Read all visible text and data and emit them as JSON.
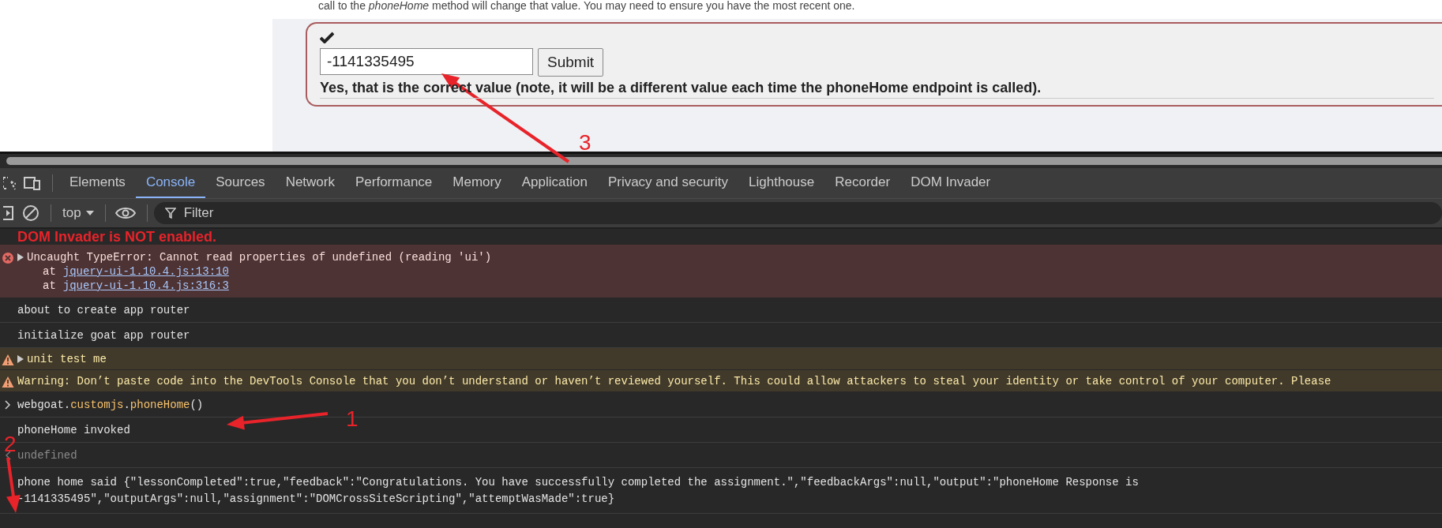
{
  "page": {
    "intro": "call to the *phoneHome* method will change that value. You may need to ensure you have the most recent one.",
    "form": {
      "checked": true,
      "answer": "-1141335495",
      "button": "Submit",
      "feedback": "Yes, that is the correct value (note, it will be a different value each time the phoneHome endpoint is called)."
    }
  },
  "devtools": {
    "tabs": [
      {
        "label": "Elements",
        "selected": false
      },
      {
        "label": "Console",
        "selected": true
      },
      {
        "label": "Sources",
        "selected": false
      },
      {
        "label": "Network",
        "selected": false
      },
      {
        "label": "Performance",
        "selected": false
      },
      {
        "label": "Memory",
        "selected": false
      },
      {
        "label": "Application",
        "selected": false
      },
      {
        "label": "Privacy and security",
        "selected": false
      },
      {
        "label": "Lighthouse",
        "selected": false
      },
      {
        "label": "Recorder",
        "selected": false
      },
      {
        "label": "DOM Invader",
        "selected": false
      }
    ],
    "context": "top",
    "filter_placeholder": "Filter",
    "banner": "DOM Invader is NOT enabled.",
    "messages": [
      {
        "kind": "error",
        "expandable": true,
        "text": "Uncaught TypeError: Cannot read properties of undefined (reading 'ui')",
        "stack": [
          {
            "prefix": "at",
            "link": "jquery-ui-1.10.4.js:13:10"
          },
          {
            "prefix": "at",
            "link": "jquery-ui-1.10.4.js:316:3"
          }
        ]
      },
      {
        "kind": "log",
        "text": "about to create app router"
      },
      {
        "kind": "log",
        "text": "initialize goat app router"
      },
      {
        "kind": "warning",
        "expandable": true,
        "text": "unit test me"
      },
      {
        "kind": "warning",
        "expandable": false,
        "text": "Warning: Don’t paste code into the DevTools Console that you don’t understand or haven’t reviewed yourself. This could allow attackers to steal your identity or take control of your computer. Please"
      },
      {
        "kind": "input",
        "parts": [
          "webgoat.",
          "customjs",
          ".",
          "phoneHome",
          "()"
        ]
      },
      {
        "kind": "log",
        "text": "phoneHome invoked"
      },
      {
        "kind": "result",
        "text": "undefined"
      },
      {
        "kind": "log",
        "lines": [
          "phone home said {\"lessonCompleted\":true,\"feedback\":\"Congratulations. You have successfully completed the assignment.\",\"feedbackArgs\":null,\"output\":\"phoneHome Response is",
          "-1141335495\",\"outputArgs\":null,\"assignment\":\"DOMCrossSiteScripting\",\"attemptWasMade\":true}"
        ]
      }
    ]
  },
  "annotations": [
    {
      "label": "3"
    },
    {
      "label": "1"
    },
    {
      "label": "2"
    }
  ]
}
